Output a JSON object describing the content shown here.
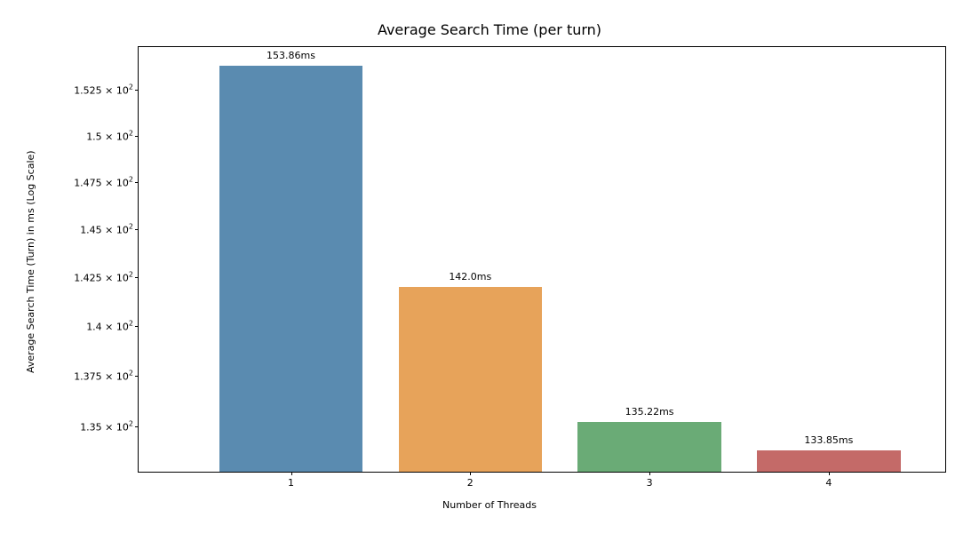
{
  "chart_data": {
    "type": "bar",
    "title": "Average Search Time (per turn)",
    "xlabel": "Number of Threads",
    "ylabel": "Average Search Time (Turn) in ms (Log Scale)",
    "categories": [
      "1",
      "2",
      "3",
      "4"
    ],
    "values": [
      153.86,
      142.0,
      135.22,
      133.85
    ],
    "value_labels": [
      "153.86ms",
      "142.0ms",
      "135.22ms",
      "133.85ms"
    ],
    "yscale": "log",
    "ylim": [
      132.8,
      154.9
    ],
    "ytick_values": [
      135.0,
      137.5,
      140.0,
      142.5,
      145.0,
      147.5,
      150.0,
      152.5
    ],
    "ytick_labels": [
      "1.35 × 10^2",
      "1.375 × 10^2",
      "1.4 × 10^2",
      "1.425 × 10^2",
      "1.45 × 10^2",
      "1.475 × 10^2",
      "1.5 × 10^2",
      "1.525 × 10^2"
    ],
    "colors": [
      "#5a8bb0",
      "#e7a35a",
      "#6aab76",
      "#c46a68"
    ]
  }
}
